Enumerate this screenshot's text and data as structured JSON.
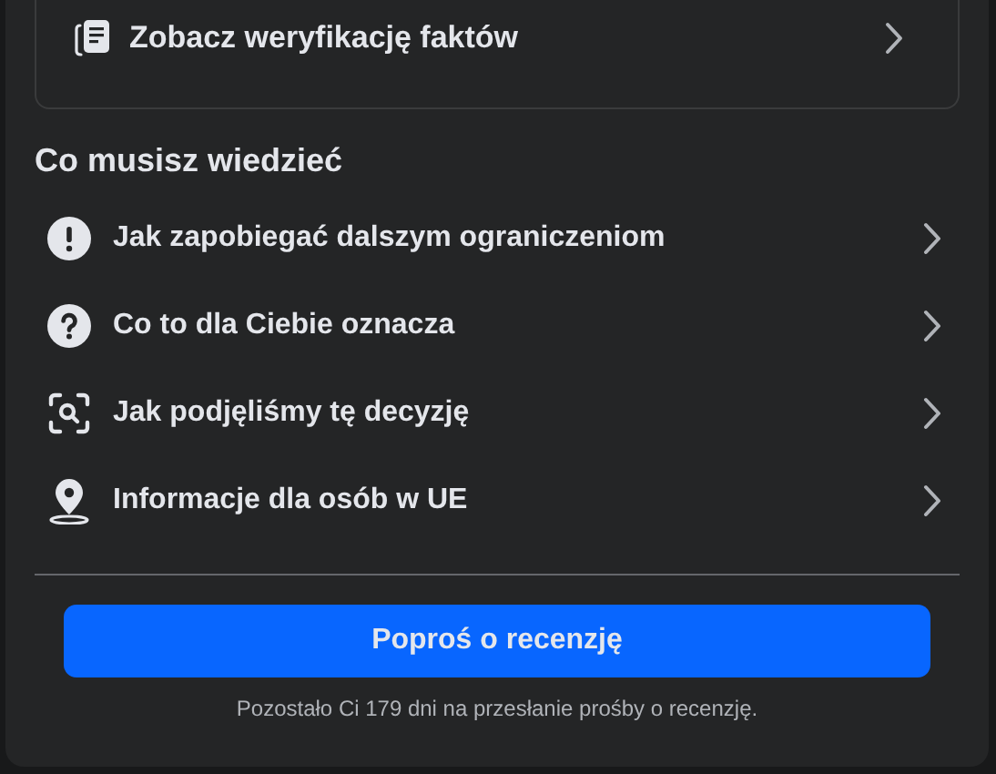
{
  "top_card": {
    "label": "Zobacz weryfikację faktów"
  },
  "section": {
    "title": "Co musisz wiedzieć",
    "items": [
      {
        "kind": "alert",
        "label": "Jak zapobiegać dalszym ograniczeniom"
      },
      {
        "kind": "question",
        "label": "Co to dla Ciebie oznacza"
      },
      {
        "kind": "scan",
        "label": "Jak podjęliśmy tę decyzję"
      },
      {
        "kind": "location",
        "label": "Informacje dla osób w UE"
      }
    ]
  },
  "button": "Poproś o recenzję",
  "note": "Pozostało Ci 179 dni na przesłanie prośby o recenzję."
}
